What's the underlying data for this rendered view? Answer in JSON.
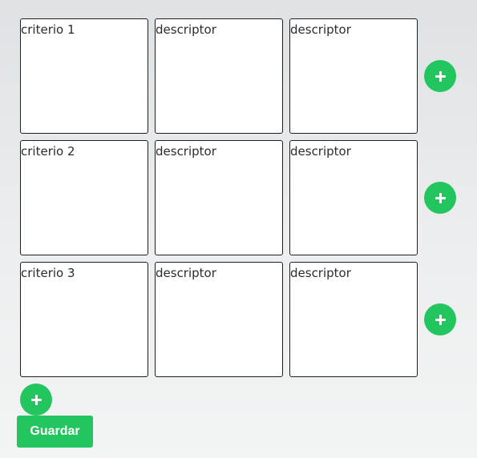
{
  "rubric": {
    "rows": [
      {
        "cells": [
          "criterio 1",
          "descriptor",
          "descriptor"
        ]
      },
      {
        "cells": [
          "criterio 2",
          "descriptor",
          "descriptor"
        ]
      },
      {
        "cells": [
          "criterio 3",
          "descriptor",
          "descriptor"
        ]
      }
    ]
  },
  "icons": {
    "add_descriptor": "plus-icon",
    "add_criterion": "plus-icon"
  },
  "actions": {
    "save_label": "Guardar"
  },
  "colors": {
    "accent": "#22c55e",
    "cell_border": "#1f1f1f",
    "cell_background": "#ffffff"
  }
}
